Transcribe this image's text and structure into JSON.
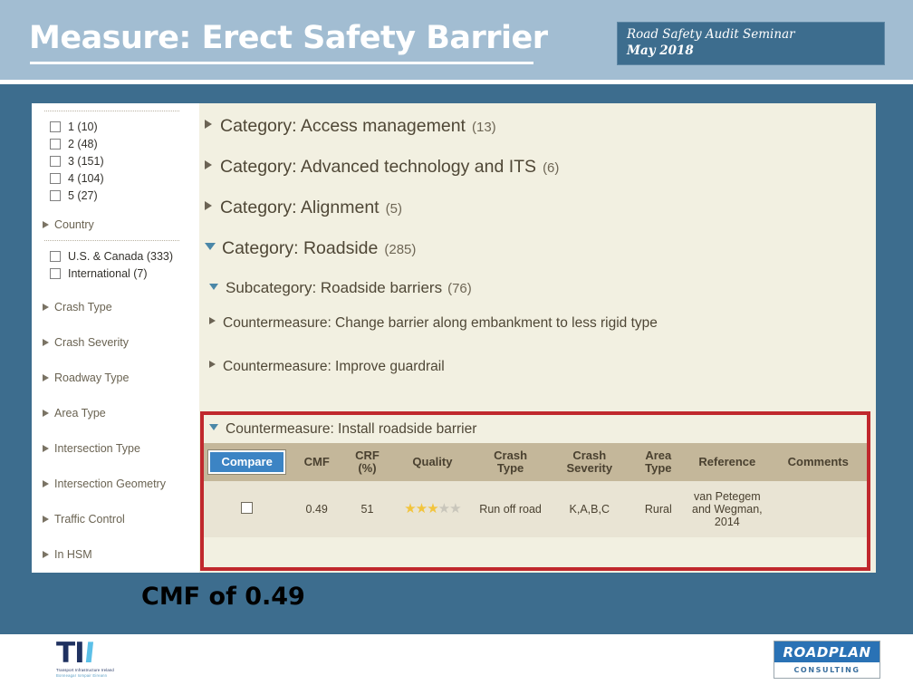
{
  "slide": {
    "title": "Measure: Erect Safety Barrier",
    "caption": "CMF of 0.49"
  },
  "seminar_box": {
    "line1": "Road Safety Audit Seminar",
    "line2": "May 2018"
  },
  "sidebar": {
    "star_filters": [
      {
        "label": "1 (10)"
      },
      {
        "label": "2 (48)"
      },
      {
        "label": "3 (151)"
      },
      {
        "label": "4 (104)"
      },
      {
        "label": "5 (27)"
      }
    ],
    "country_group": {
      "label": "Country"
    },
    "country_filters": [
      {
        "label": "U.S. & Canada (333)"
      },
      {
        "label": "International (7)"
      }
    ],
    "groups": [
      {
        "label": "Crash Type"
      },
      {
        "label": "Crash Severity"
      },
      {
        "label": "Roadway Type"
      },
      {
        "label": "Area Type"
      },
      {
        "label": "Intersection Type"
      },
      {
        "label": "Intersection Geometry"
      },
      {
        "label": "Traffic Control"
      },
      {
        "label": "In HSM"
      }
    ]
  },
  "main": {
    "categories": [
      {
        "label": "Category: Access management",
        "count": "(13)",
        "expanded": false
      },
      {
        "label": "Category: Advanced technology and ITS",
        "count": "(6)",
        "expanded": false
      },
      {
        "label": "Category: Alignment",
        "count": "(5)",
        "expanded": false
      },
      {
        "label": "Category: Roadside",
        "count": "(285)",
        "expanded": true
      }
    ],
    "subcategory": {
      "label": "Subcategory: Roadside barriers",
      "count": "(76)"
    },
    "countermeasures": [
      {
        "label": "Countermeasure: Change barrier along embankment to less rigid type"
      },
      {
        "label": "Countermeasure: Improve guardrail"
      }
    ],
    "selected_countermeasure": {
      "label": "Countermeasure: Install roadside barrier"
    }
  },
  "table": {
    "compare_label": "Compare",
    "columns": [
      "CMF",
      "CRF\n(%)",
      "Quality",
      "Crash\nType",
      "Crash\nSeverity",
      "Area\nType",
      "Reference",
      "Comments"
    ],
    "col_cmf": "CMF",
    "col_crf_l1": "CRF",
    "col_crf_l2": "(%)",
    "col_quality": "Quality",
    "col_crash_type_l1": "Crash",
    "col_crash_type_l2": "Type",
    "col_crash_sev_l1": "Crash",
    "col_crash_sev_l2": "Severity",
    "col_area_type_l1": "Area",
    "col_area_type_l2": "Type",
    "col_reference": "Reference",
    "col_comments": "Comments",
    "rows": [
      {
        "cmf": "0.49",
        "crf": "51",
        "quality_stars": 3,
        "quality_max": 5,
        "crash_type": "Run off road",
        "crash_severity": "K,A,B,C",
        "area_type": "Rural",
        "reference": "van Petegem and Wegman, 2014",
        "comments": ""
      }
    ]
  },
  "footer": {
    "tii_mark_a": "TI",
    "tii_mark_b": "I",
    "tii_sub1": "Transport Infrastructure Ireland",
    "tii_sub2": "Bonneagar Iompair Eireann",
    "roadplan_top": "ROADPLAN",
    "roadplan_bottom": "CONSULTING"
  },
  "colors": {
    "slide_bg": "#3d6d8e",
    "header_band": "#a2bdd2",
    "panel_bg": "#f2f0e1",
    "table_header": "#c4b79a",
    "table_row": "#e9e4d4",
    "highlight_red": "#c0282d",
    "accent_blue": "#3c84c4",
    "star_gold": "#f2c43c"
  }
}
